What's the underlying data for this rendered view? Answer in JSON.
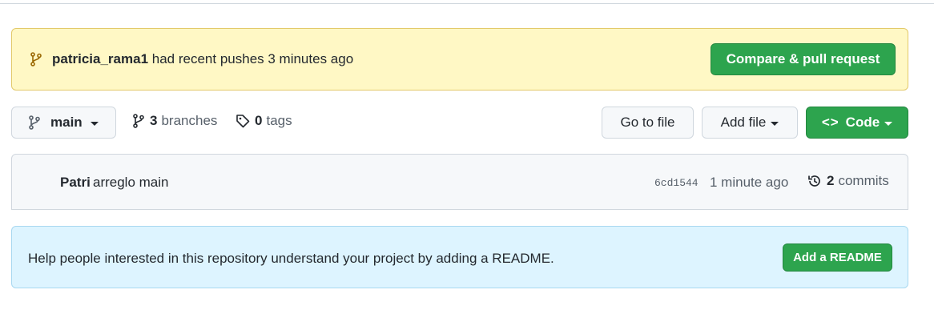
{
  "push_banner": {
    "user": "patricia_rama1",
    "message": "had recent pushes 3 minutes ago",
    "button_label": "Compare & pull request"
  },
  "toolbar": {
    "branch": "main",
    "branches_count": "3",
    "branches_label": "branches",
    "tags_count": "0",
    "tags_label": "tags",
    "goto_file_label": "Go to file",
    "add_file_label": "Add file",
    "code_label": "Code"
  },
  "commit": {
    "author": "Patri",
    "message": "arreglo main",
    "sha": "6cd1544",
    "time": "1 minute ago",
    "commits_count": "2",
    "commits_label": "commits"
  },
  "readme_banner": {
    "text": "Help people interested in this repository understand your project by adding a README.",
    "button_label": "Add a README"
  },
  "colors": {
    "green": "#2da44e",
    "yellow_banner": "#fff8c5",
    "blue_banner": "#ddf4ff"
  }
}
